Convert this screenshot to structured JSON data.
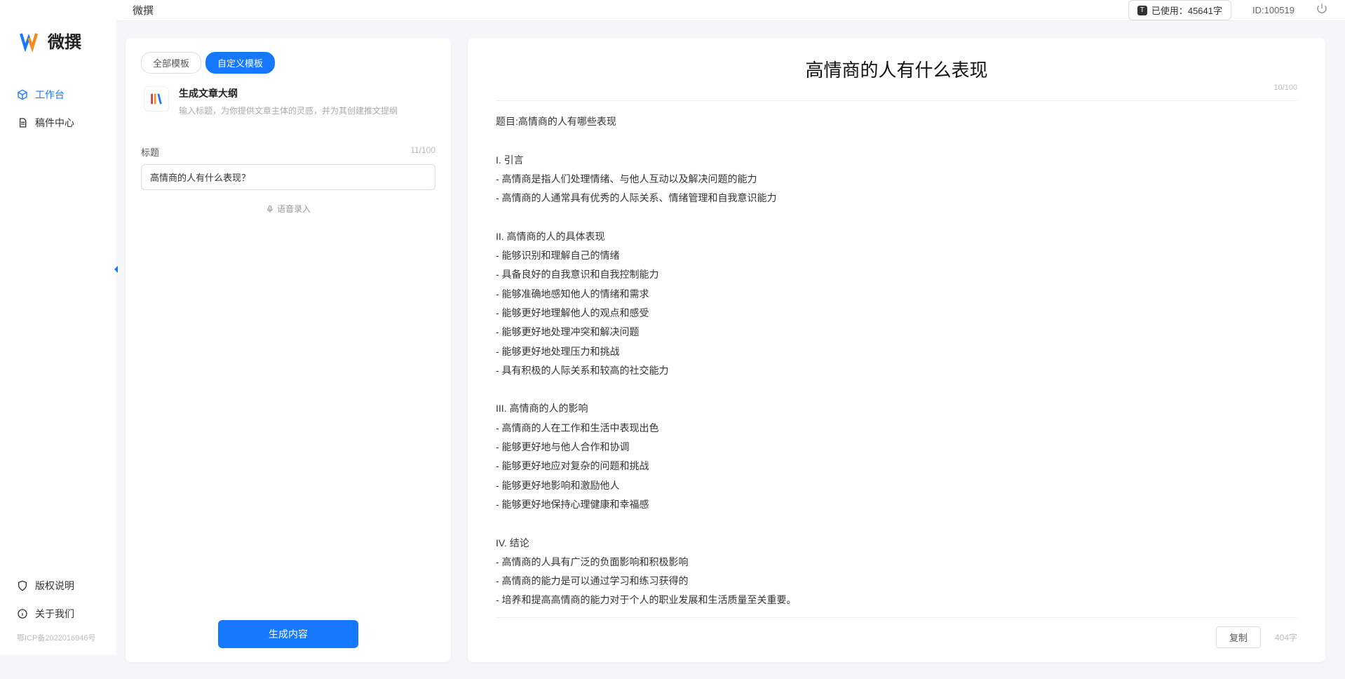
{
  "app": {
    "logo_text": "微撰",
    "topbar_title": "微撰"
  },
  "header": {
    "usage_label": "已使用：45641字",
    "user_id": "ID:100519"
  },
  "sidebar": {
    "nav": [
      {
        "label": "工作台",
        "icon": "cube-icon",
        "active": true
      },
      {
        "label": "稿件中心",
        "icon": "doc-icon",
        "active": false
      }
    ],
    "bottom": [
      {
        "label": "版权说明",
        "icon": "shield-icon"
      },
      {
        "label": "关于我们",
        "icon": "info-icon"
      }
    ],
    "icp": "鄂ICP备2022016946号"
  },
  "left": {
    "tabs": [
      {
        "label": "全部模板",
        "active": false
      },
      {
        "label": "自定义模板",
        "active": true
      }
    ],
    "template": {
      "title": "生成文章大纲",
      "desc": "输入标题，为你提供文章主体的灵感，并为其创建推文提纲"
    },
    "field_label": "标题",
    "char_counter": "11/100",
    "input_value": "高情商的人有什么表现？",
    "voice_label": "语音录入",
    "generate_label": "生成内容"
  },
  "output": {
    "title": "高情商的人有什么表现",
    "title_counter": "10/100",
    "body": "题目:高情商的人有哪些表现\n\nI. 引言\n- 高情商是指人们处理情绪、与他人互动以及解决问题的能力\n- 高情商的人通常具有优秀的人际关系、情绪管理和自我意识能力\n\nII. 高情商的人的具体表现\n- 能够识别和理解自己的情绪\n- 具备良好的自我意识和自我控制能力\n- 能够准确地感知他人的情绪和需求\n- 能够更好地理解他人的观点和感受\n- 能够更好地处理冲突和解决问题\n- 能够更好地处理压力和挑战\n- 具有积极的人际关系和较高的社交能力\n\nIII. 高情商的人的影响\n- 高情商的人在工作和生活中表现出色\n- 能够更好地与他人合作和协调\n- 能够更好地应对复杂的问题和挑战\n- 能够更好地影响和激励他人\n- 能够更好地保持心理健康和幸福感\n\nIV. 结论\n- 高情商的人具有广泛的负面影响和积极影响\n- 高情商的能力是可以通过学习和练习获得的\n- 培养和提高高情商的能力对于个人的职业发展和生活质量至关重要。",
    "copy_label": "复制",
    "word_count": "404字"
  }
}
